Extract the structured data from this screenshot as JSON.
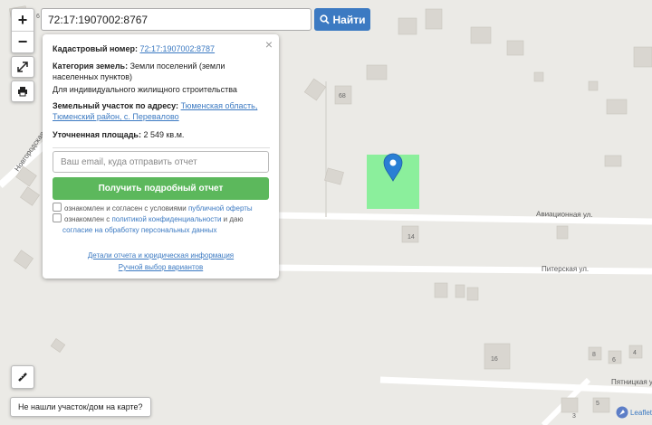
{
  "search": {
    "value": "72:17:1907002:8767",
    "button_label": "Найти"
  },
  "controls": {
    "zoom_in": "+",
    "zoom_out": "−"
  },
  "popup": {
    "close": "×",
    "cad_label": "Кадастровый номер:",
    "cad_value": "72:17:1907002:8787",
    "category_label": "Категория земель:",
    "category_value": "Земли поселений (земли населенных пунктов)",
    "usage": "Для индивидуального жилищного строительства",
    "address_label": "Земельный участок по адресу:",
    "address_value": "Тюменская область, Тюменский район, с. Перевалово",
    "area_label": "Уточненная площадь:",
    "area_value": "2 549 кв.м.",
    "email_placeholder": "Ваш email, куда отправить отчет",
    "report_button": "Получить подробный отчет",
    "agree1_prefix": "ознакомлен и согласен с условиями",
    "agree1_link": "публичной оферты",
    "agree2_prefix": "ознакомлен с",
    "agree2_link": "политикой конфиденциальности",
    "agree2_mid": "и даю",
    "agree2_link2": "согласие на обработку персональных данных",
    "details_link": "Детали отчета и юридическая информация",
    "manual_link": "Ручной выбор вариантов"
  },
  "map": {
    "streets": [
      "Новгородская",
      "Авиационная ул.",
      "Питерская ул.",
      "Пятницкая ул."
    ],
    "house_numbers": [
      "6",
      "68",
      "14",
      "16",
      "8",
      "6",
      "4",
      "5",
      "3"
    ]
  },
  "bottom": {
    "not_found": "Не нашли участок/дом на карте?",
    "attribution": "Leaflet"
  },
  "colors": {
    "parcel": "#7af08e",
    "marker": "#2a7fd4",
    "accent": "#3c7ac2",
    "button_green": "#5cb85c"
  }
}
